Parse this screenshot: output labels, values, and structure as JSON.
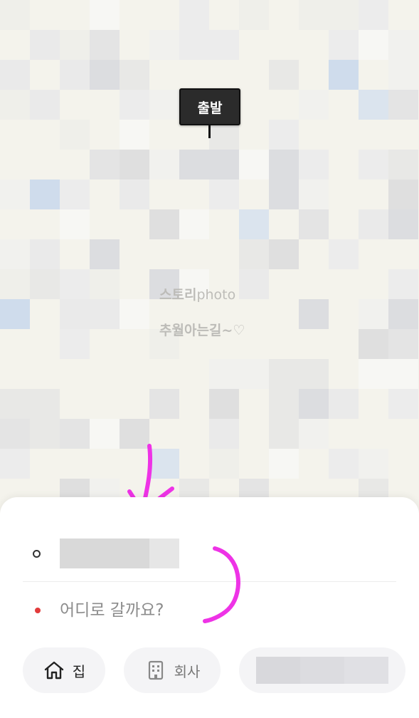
{
  "map": {
    "start_marker_label": "출발",
    "watermark_line1": "스토리",
    "watermark_line1_suffix": "photo",
    "watermark_line2": "추월아는길~♡",
    "annotation_color": "#ee33e6"
  },
  "route": {
    "origin_value": "",
    "destination_placeholder": "어디로 갈까요?",
    "destination_value": "",
    "origin_dot_color": "#333333",
    "destination_dot_color": "#e23b3b"
  },
  "shortcuts": {
    "home": {
      "label": "집",
      "icon": "home-icon"
    },
    "work": {
      "label": "회사",
      "icon": "building-icon"
    },
    "extra": {
      "label": ""
    }
  }
}
